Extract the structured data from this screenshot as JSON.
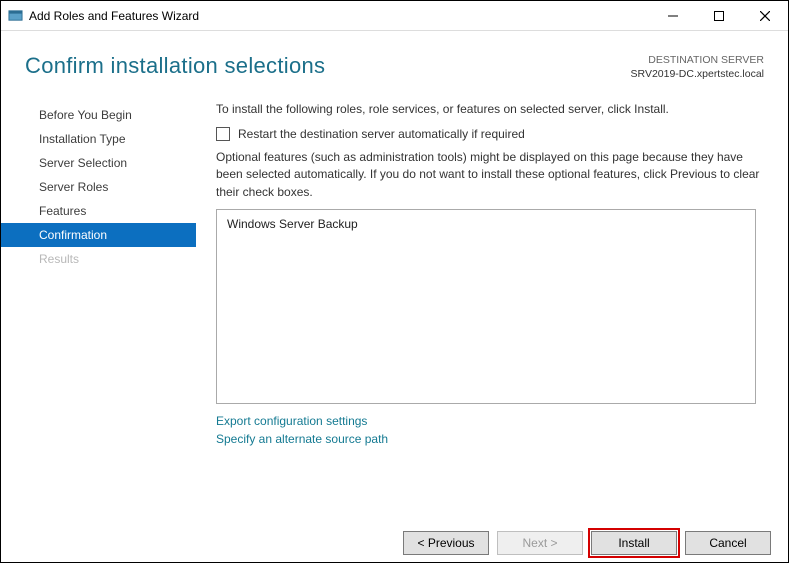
{
  "titlebar": {
    "title": "Add Roles and Features Wizard"
  },
  "header": {
    "page_title": "Confirm installation selections",
    "dest_heading": "DESTINATION SERVER",
    "dest_name": "SRV2019-DC.xpertstec.local"
  },
  "sidebar": {
    "items": [
      {
        "label": "Before You Begin"
      },
      {
        "label": "Installation Type"
      },
      {
        "label": "Server Selection"
      },
      {
        "label": "Server Roles"
      },
      {
        "label": "Features"
      },
      {
        "label": "Confirmation"
      },
      {
        "label": "Results"
      }
    ]
  },
  "main": {
    "intro": "To install the following roles, role services, or features on selected server, click Install.",
    "restart_label": "Restart the destination server automatically if required",
    "optional_note": "Optional features (such as administration tools) might be displayed on this page because they have been selected automatically. If you do not want to install these optional features, click Previous to clear their check boxes.",
    "selected_feature": "Windows Server Backup",
    "export_link": "Export configuration settings",
    "alt_source_link": "Specify an alternate source path"
  },
  "footer": {
    "previous": "< Previous",
    "next": "Next >",
    "install": "Install",
    "cancel": "Cancel"
  }
}
